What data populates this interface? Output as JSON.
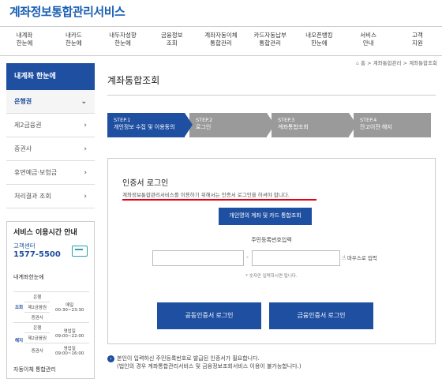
{
  "logo": "계좌정보통합관리서비스",
  "nav": [
    "내계좌\n한눈에",
    "내카드\n한눈에",
    "내두자성향\n한눈에",
    "금융정보\n조회",
    "계좌자동이체\n통합관리",
    "카드자동납부\n통합관리",
    "내오픈뱅킹\n한눈에",
    "서비스\n안내",
    "고객\n지원"
  ],
  "breadcrumb": {
    "home": "홈",
    "parent": "계좌통합관리",
    "current": "계좌통합조회"
  },
  "sidebar": {
    "header": "내계좌 한눈에",
    "items": [
      {
        "label": "은행권",
        "active": true
      },
      {
        "label": "제2금융권",
        "active": false
      },
      {
        "label": "증권사",
        "active": false
      },
      {
        "label": "휴면예금·보험금",
        "active": false
      },
      {
        "label": "처리결과 조회",
        "active": false
      }
    ]
  },
  "service": {
    "title": "서비스 이용시간 안내",
    "cc_label": "고객센터",
    "cc_phone": "1577-5500",
    "sub1": "내계좌한눈에",
    "rows": [
      [
        "조회",
        "은행",
        ""
      ],
      [
        "",
        "제2금융권",
        "매일\n00:30~23:30"
      ],
      [
        "",
        "증권사",
        ""
      ],
      [
        "해지",
        "은행",
        ""
      ],
      [
        "",
        "제2금융권",
        "영업일\n09:00~22:00"
      ],
      [
        "",
        "증권사",
        "영업일\n09:00~16:00"
      ]
    ],
    "sub2": "자동이체 통합관리"
  },
  "main": {
    "title": "계좌통합조회",
    "steps": [
      {
        "num": "STEP.1",
        "label": "개인정보 수집 및 이용동의"
      },
      {
        "num": "STEP.2",
        "label": "로그인"
      },
      {
        "num": "STEP.3",
        "label": "계좌통합조회"
      },
      {
        "num": "STEP.4",
        "label": "잔고이전·해지"
      }
    ]
  },
  "cert": {
    "title": "인증서 로그인",
    "desc": "계좌정보통합관리서비스를 이용하기 위해서는 인증서 로그인을 하셔야 합니다.",
    "combined_button": "개인명의 계좌 및 카드 통합조회",
    "rrn_label": "주민등록번호입력",
    "rrn_dash": "-",
    "mouse_input": "마우스로 입력",
    "rrn_hint": "* 숫자만 입력하시면 됩니다.",
    "login_common": "공동인증서 로그인",
    "login_finance": "금융인증서 로그인"
  },
  "notice": {
    "line1": "본인이 입력하신 주민등록번호로 발급된 인증서가 필요합니다.",
    "line2": "(법인의 경우 계좌통합관리서비스 및 금융정보조회서비스 이용이 불가능합니다.)"
  },
  "colors": {
    "brand": "#1f4fa0",
    "step_inactive": "#9a9a9a",
    "highlight": "#e60012"
  }
}
